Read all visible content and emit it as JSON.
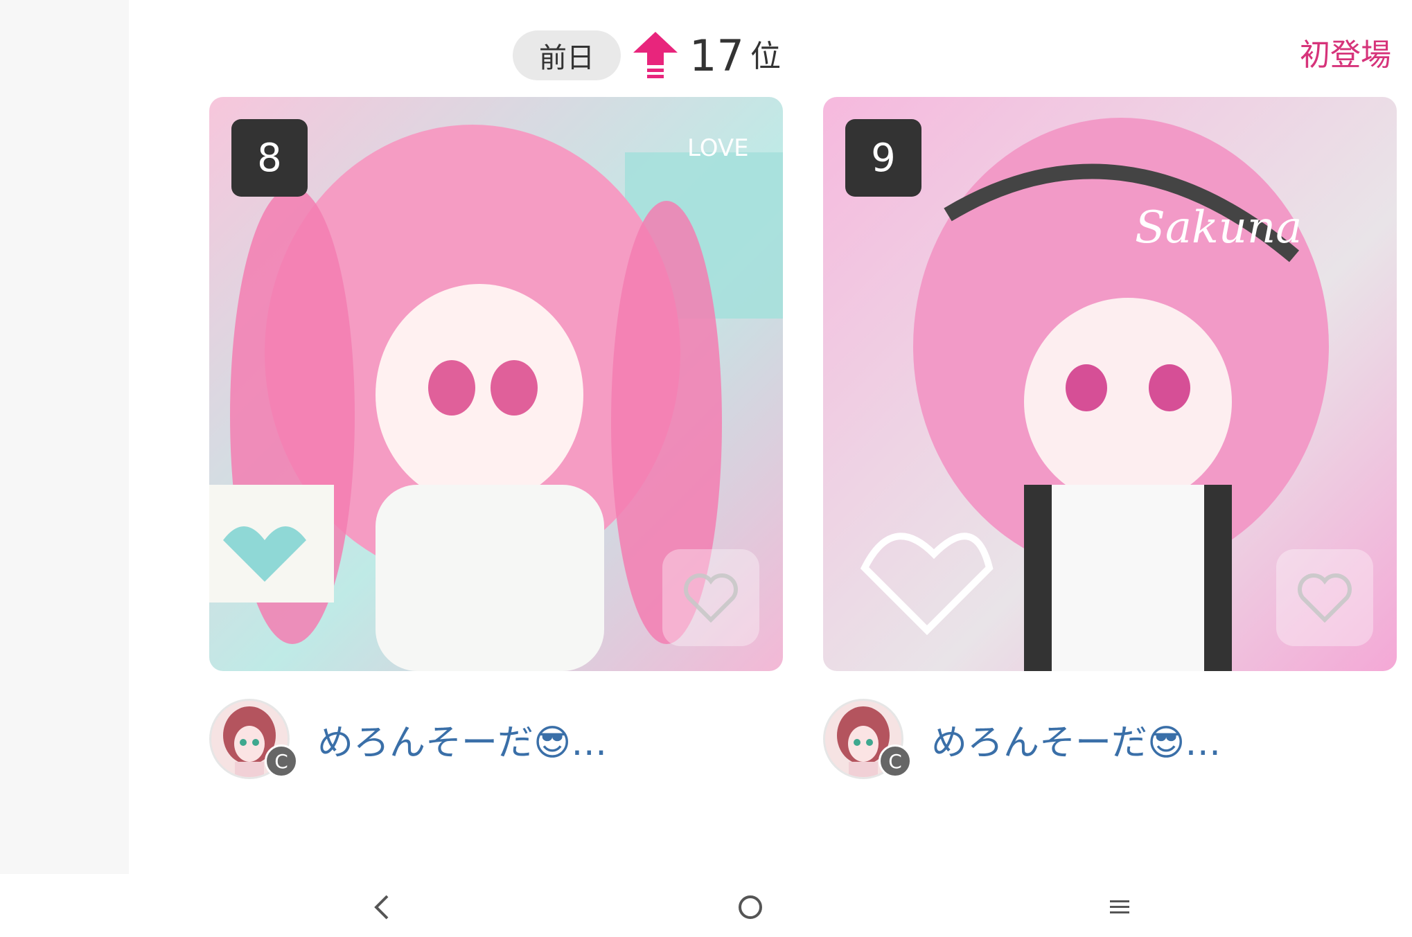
{
  "ranking": {
    "previous_day_label": "前日",
    "trend_direction": "up",
    "previous_rank": "17",
    "rank_unit": "位"
  },
  "new_entry_label": "初登場",
  "colors": {
    "accent_pink": "#e8257c",
    "new_entry_text": "#d6337a",
    "author_name": "#3a6fa8",
    "badge_bg": "#333333"
  },
  "cards": [
    {
      "rank": "8",
      "artwork_text": "LOVE",
      "author": {
        "name": "めろんそーだ😎…",
        "badge": "C"
      }
    },
    {
      "rank": "9",
      "artwork_text": "Sakuna",
      "author": {
        "name": "めろんそーだ😎…",
        "badge": "C"
      }
    }
  ],
  "icons": {
    "arrow": "up-arrow-icon",
    "like": "heart-icon",
    "nav_back": "back-chevron-icon",
    "nav_home": "home-circle-icon",
    "nav_menu": "menu-lines-icon"
  }
}
